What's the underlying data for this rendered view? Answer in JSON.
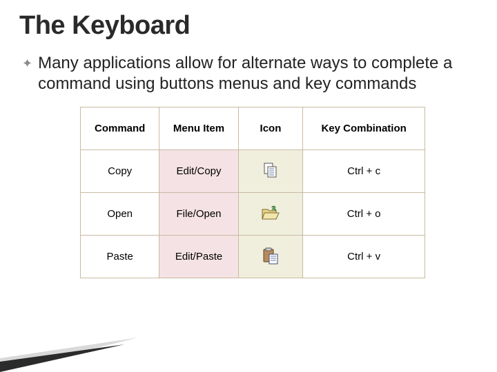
{
  "title": "The Keyboard",
  "paragraph": "Many applications allow for alternate ways to complete a command using buttons menus and key commands",
  "table": {
    "headers": {
      "command": "Command",
      "menu": "Menu Item",
      "icon": "Icon",
      "key": "Key Combination"
    },
    "rows": [
      {
        "command": "Copy",
        "menu": "Edit/Copy",
        "icon": "copy-icon",
        "key": "Ctrl + c"
      },
      {
        "command": "Open",
        "menu": "File/Open",
        "icon": "open-icon",
        "key": "Ctrl + o"
      },
      {
        "command": "Paste",
        "menu": "Edit/Paste",
        "icon": "paste-icon",
        "key": "Ctrl + v"
      }
    ]
  }
}
